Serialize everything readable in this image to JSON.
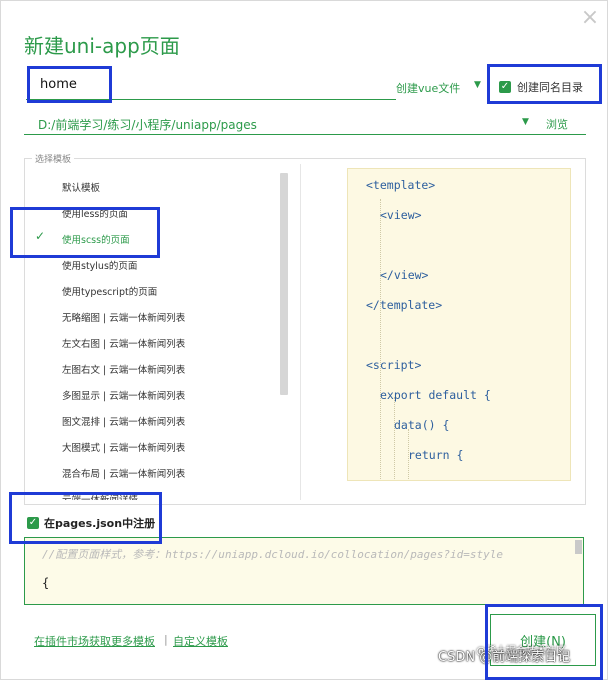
{
  "dialog": {
    "title": "新建uni-app页面",
    "close_icon": "close-icon"
  },
  "form": {
    "page_name": "home",
    "file_type": "创建vue文件",
    "create_same_dir_label": "创建同名目录",
    "create_same_dir_checked": true,
    "path": "D:/前端学习/练习/小程序/uniapp/pages",
    "browse_label": "浏览"
  },
  "templates": {
    "legend": "选择模板",
    "items": [
      {
        "label": "默认模板",
        "selected": false
      },
      {
        "label": "使用less的页面",
        "selected": false
      },
      {
        "label": "使用scss的页面",
        "selected": true
      },
      {
        "label": "使用stylus的页面",
        "selected": false
      },
      {
        "label": "使用typescript的页面",
        "selected": false
      },
      {
        "label": "无略缩图 | 云端一体新闻列表",
        "selected": false
      },
      {
        "label": "左文右图 | 云端一体新闻列表",
        "selected": false
      },
      {
        "label": "左图右文 | 云端一体新闻列表",
        "selected": false
      },
      {
        "label": "多图显示 | 云端一体新闻列表",
        "selected": false
      },
      {
        "label": "图文混排 | 云端一体新闻列表",
        "selected": false
      },
      {
        "label": "大图模式 | 云端一体新闻列表",
        "selected": false
      },
      {
        "label": "混合布局 | 云端一体新闻列表",
        "selected": false
      },
      {
        "label": "云端一体新闻详情",
        "selected": false
      }
    ]
  },
  "preview": {
    "lines": [
      "<template>",
      "<view>",
      "</view>",
      "</template>",
      "<script>",
      "export default {",
      "data() {",
      "return {"
    ]
  },
  "pages_json": {
    "label": "在pages.json中注册",
    "checked": true,
    "comment": "//配置页面样式，参考：https://uniapp.dcloud.io/collocation/pages?id=style",
    "brace": "{"
  },
  "footer": {
    "market_link": "在插件市场获取更多模板",
    "separator": "|",
    "custom_link": "自定义模板",
    "create_button": "创建(N)"
  },
  "watermark": {
    "text": "CSDN @前端探索日记",
    "line2": "@稀土掘金技术社区"
  },
  "colors": {
    "accent": "#2c9a4a",
    "annotation_box": "#1f3bd6",
    "code_bg": "#fdf9e3"
  }
}
